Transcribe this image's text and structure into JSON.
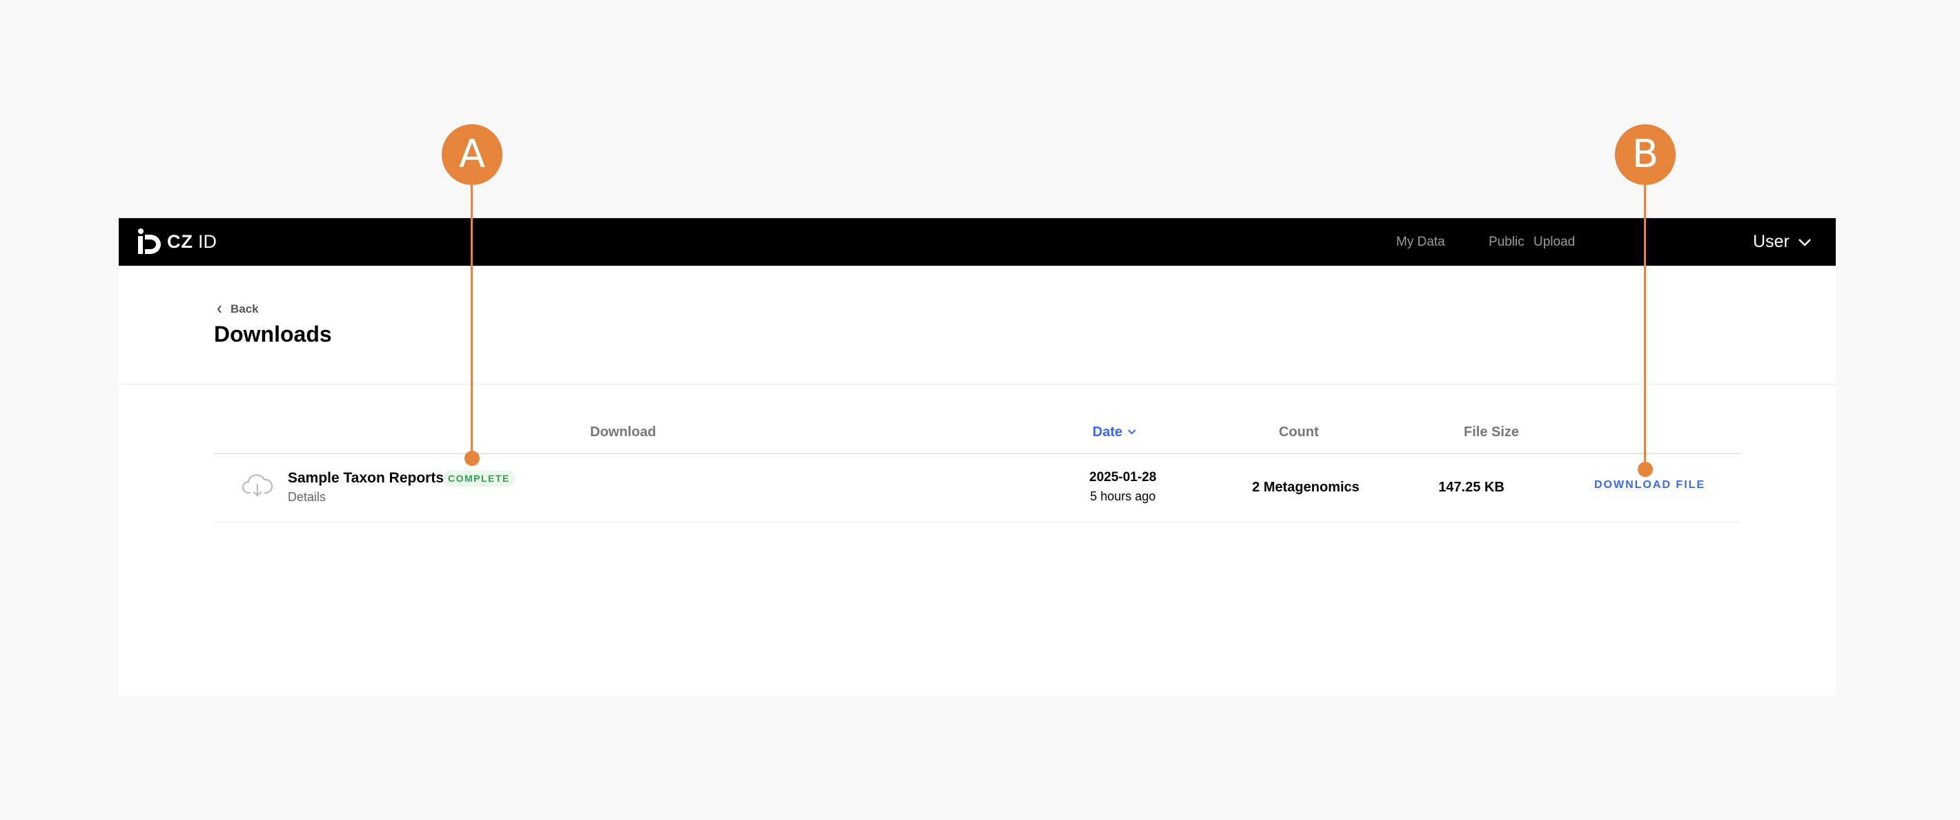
{
  "navbar": {
    "logo_cz": "CZ",
    "logo_id": "ID",
    "links": [
      "My Data",
      "Public",
      "Upload"
    ],
    "user_label": "User"
  },
  "page": {
    "back_label": "Back",
    "title": "Downloads"
  },
  "table": {
    "columns": [
      "Download",
      "Date",
      "Count",
      "File Size"
    ],
    "sorted_column": "Date",
    "rows": [
      {
        "name": "Sample Taxon Reports",
        "status": "COMPLETE",
        "details": "Details",
        "date": "2025-01-28",
        "date_relative": "5 hours ago",
        "count": "2 Metagenomics",
        "file_size": "147.25 KB",
        "action": "DOWNLOAD FILE",
        "icon": "cloud-download-icon"
      }
    ]
  },
  "callouts": [
    "A",
    "B"
  ],
  "colors": {
    "accent": "#3867fa",
    "callout": "#e7843b",
    "status_complete": "#2ea04f",
    "navbar_bg": "#000000"
  }
}
